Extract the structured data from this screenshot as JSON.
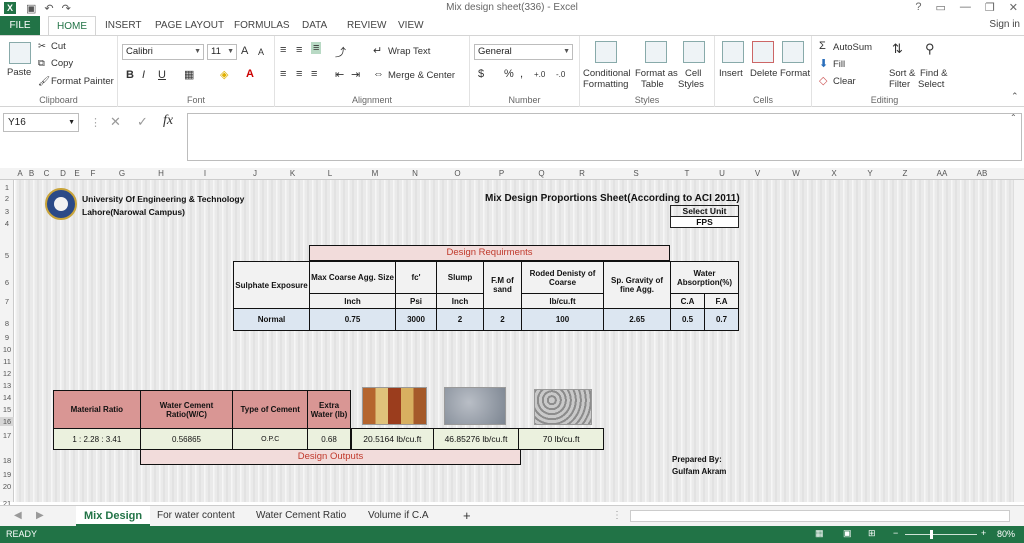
{
  "window": {
    "title": "Mix design sheet(336) - Excel",
    "logo": "X",
    "help": "?",
    "controls": [
      "▭",
      "—",
      "❐",
      "✕"
    ]
  },
  "qat": [
    "save-icon",
    "undo-icon",
    "redo-icon"
  ],
  "ribbon_tabs": {
    "file": "FILE",
    "tabs": [
      "HOME",
      "INSERT",
      "PAGE LAYOUT",
      "FORMULAS",
      "DATA",
      "REVIEW",
      "VIEW"
    ],
    "active": "HOME",
    "signin": "Sign in"
  },
  "clipboard": {
    "paste": "Paste",
    "cut": "Cut",
    "copy": "Copy",
    "format_painter": "Format Painter",
    "label": "Clipboard"
  },
  "font": {
    "name": "Calibri",
    "size": "11",
    "grow": "A",
    "shrink": "A",
    "label": "Font",
    "bold": "B",
    "italic": "I",
    "underline": "U"
  },
  "alignment": {
    "wrap_text": "Wrap Text",
    "merge_center": "Merge & Center",
    "label": "Alignment"
  },
  "number": {
    "format": "General",
    "label": "Number",
    "currency": "$",
    "percent": "%",
    "comma": ",",
    "inc_decimal": "+.0",
    "dec_decimal": "-.0"
  },
  "styles": {
    "conditional": "Conditional",
    "conditional2": "Formatting",
    "format_as": "Format as",
    "format_as2": "Table",
    "cell": "Cell",
    "cell2": "Styles",
    "label": "Styles"
  },
  "cells": {
    "insert": "Insert",
    "delete": "Delete",
    "format": "Format",
    "label": "Cells"
  },
  "editing": {
    "autosum": "AutoSum",
    "fill": "Fill",
    "clear": "Clear",
    "sort": "Sort &",
    "sort2": "Filter",
    "find": "Find &",
    "find2": "Select",
    "label": "Editing"
  },
  "formula_bar": {
    "name_box": "Y16",
    "cancel": "✕",
    "enter": "✓",
    "fx": "fx",
    "formula": ""
  },
  "columns": [
    "A",
    "B",
    "C",
    "D",
    "E",
    "F",
    "G",
    "H",
    "I",
    "J",
    "K",
    "L",
    "M",
    "N",
    "O",
    "P",
    "Q",
    "R",
    "S",
    "T",
    "U",
    "V",
    "W",
    "X",
    "Y",
    "Z",
    "AA",
    "AB"
  ],
  "rows": [
    "1",
    "2",
    "3",
    "4",
    "5",
    "6",
    "7",
    "8",
    "9",
    "10",
    "11",
    "12",
    "13",
    "14",
    "15",
    "16",
    "17",
    "18",
    "19",
    "20",
    "21"
  ],
  "header": {
    "university": "University Of Engineering & Technology",
    "campus": "Lahore(Narowal Campus)",
    "sheet_title": "Mix Design Proportions Sheet(According to ACI 2011)",
    "select_unit": "Select Unit",
    "unit": "FPS"
  },
  "requirements": {
    "title": "Design Requirments",
    "columns": [
      {
        "label": "Sulphate Exposure",
        "unit": "",
        "value": "Normal"
      },
      {
        "label": "Max Coarse Agg. Size",
        "unit": "Inch",
        "value": "0.75"
      },
      {
        "label": "fc'",
        "unit": "Psi",
        "value": "3000"
      },
      {
        "label": "Slump",
        "unit": "Inch",
        "value": "2"
      },
      {
        "label": "F.M of sand",
        "unit": "",
        "value": "2"
      },
      {
        "label": "Roded Denisty of Coarse",
        "unit": "lb/cu.ft",
        "value": "100"
      },
      {
        "label": "Sp. Gravity of fine Agg.",
        "unit": "",
        "value": "2.65"
      }
    ],
    "water_absorption": {
      "label": "Water Absorption(%)",
      "ca": "C.A",
      "fa": "F.A",
      "ca_value": "0.5",
      "fa_value": "0.7"
    }
  },
  "outputs": {
    "title": "Design Outputs",
    "material_ratio": {
      "label": "Material Ratio",
      "value": "1   :  2.28  :  3.41"
    },
    "wc_ratio": {
      "label": "Water Cement Ratio(W/C)",
      "value": "0.56865"
    },
    "cement_type": {
      "label": "Type of Cement",
      "value": "O.P.C"
    },
    "extra_water": {
      "label": "Extra Water (lb)",
      "value": "0.68"
    },
    "cement": {
      "value": "20.5164  lb/cu.ft"
    },
    "sand": {
      "value": "46.85276  lb/cu.ft"
    },
    "aggregate": {
      "value": "70  lb/cu.ft"
    }
  },
  "prepared": {
    "label": "Prepared By:",
    "name": "Gulfam Akram"
  },
  "sheet_tabs": [
    "Mix Design",
    "For water content",
    "Water Cement Ratio",
    "Volume if C.A"
  ],
  "active_sheet": "Mix Design",
  "add_sheet": "+",
  "status": {
    "ready": "READY",
    "zoom": "80%",
    "minus": "−",
    "plus": "+"
  },
  "colors": {
    "accent": "#217346",
    "pink_header": "#d99694",
    "design_bar": "#f2dcdb",
    "design_text": "#c0392b",
    "value_blue": "#dce6f1",
    "output_green": "#ebf1de"
  }
}
